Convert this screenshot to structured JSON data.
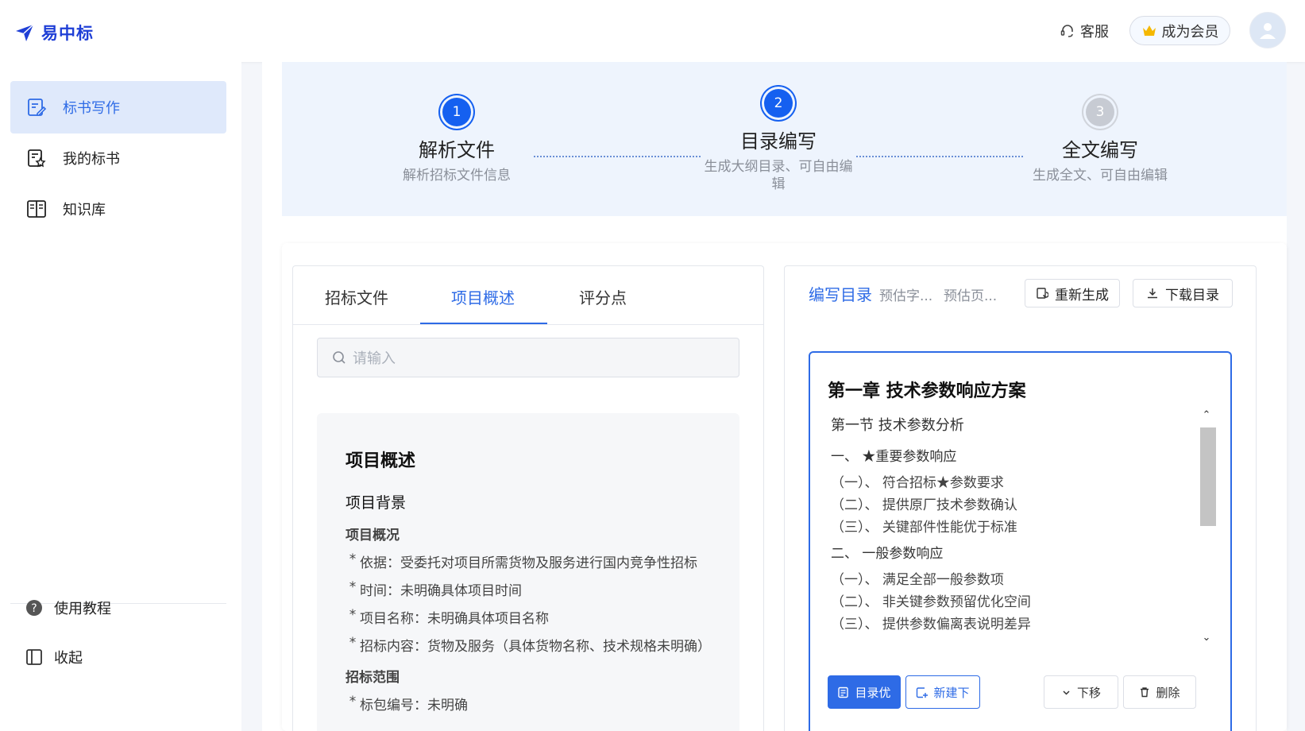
{
  "header": {
    "logo_text": "易中标",
    "support_label": "客服",
    "vip_label": "成为会员"
  },
  "sidebar": {
    "items": [
      {
        "label": "标书写作",
        "icon": "document-edit-icon"
      },
      {
        "label": "我的标书",
        "icon": "document-star-icon"
      },
      {
        "label": "知识库",
        "icon": "book-icon"
      }
    ],
    "tutorial_label": "使用教程",
    "collapse_label": "收起"
  },
  "steps": [
    {
      "number": "1",
      "title": "解析文件",
      "desc": "解析招标文件信息",
      "state": "done"
    },
    {
      "number": "2",
      "title": "目录编写",
      "desc_line1": "生成大纲目录、可自由编",
      "desc_line2": "辑",
      "state": "active"
    },
    {
      "number": "3",
      "title": "全文编写",
      "desc": "生成全文、可自由编辑",
      "state": "pending"
    }
  ],
  "left": {
    "tabs": [
      "招标文件",
      "项目概述",
      "评分点"
    ],
    "active_tab": "项目概述",
    "search_placeholder": "请输入",
    "summary": {
      "title": "项目概述",
      "background_heading": "项目背景",
      "overview_heading": "项目概况",
      "overview_items": [
        "依据：受委托对项目所需货物及服务进行国内竞争性招标",
        "时间：未明确具体项目时间",
        "项目名称：未明确具体项目名称",
        "招标内容：货物及服务（具体货物名称、技术规格未明确）"
      ],
      "scope_heading": "招标范围",
      "scope_items": [
        "标包编号：未明确"
      ]
    }
  },
  "right": {
    "title": "编写目录",
    "est_words": "预估字...",
    "est_pages": "预估页...",
    "regenerate_label": "重新生成",
    "download_label": "下载目录",
    "chapter_title": "第一章 技术参数响应方案",
    "toc": {
      "section": "第一节  技术参数分析",
      "groups": [
        {
          "heading": "一、  ★重要参数响应",
          "items": [
            "（一）、  符合招标★参数要求",
            "（二）、  提供原厂技术参数确认",
            "（三）、  关键部件性能优于标准"
          ]
        },
        {
          "heading": "二、  一般参数响应",
          "items": [
            "（一）、  满足全部一般参数项",
            "（二）、  非关键参数预留优化空间",
            "（三）、  提供参数偏离表说明差异"
          ]
        }
      ]
    },
    "buttons": {
      "optimize": "目录优",
      "new_below": "新建下",
      "move_down": "下移",
      "delete": "删除"
    }
  },
  "colors": {
    "primary": "#2e6be6",
    "step_blue": "#1560f0",
    "sidebar_active_bg": "#dfe9fb",
    "steps_bg": "#eef4fd"
  }
}
